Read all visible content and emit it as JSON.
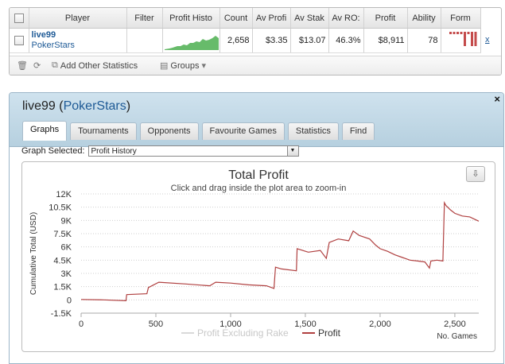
{
  "stats_table": {
    "headers": [
      "Player",
      "Filter",
      "Profit Histo",
      "Count",
      "Av Profi",
      "Av Stak",
      "Av RO:",
      "Profit",
      "Ability",
      "Form"
    ],
    "row": {
      "player": "live99",
      "site": "PokerStars",
      "filter": "",
      "count": "2,658",
      "av_profit": "$3.35",
      "av_stake": "$13.07",
      "av_roi": "46.3%",
      "profit": "$8,911",
      "ability": "78",
      "remove": "x"
    },
    "form_bars": [
      0.15,
      0.15,
      0.15,
      0.15,
      0.9,
      0.15,
      0.9,
      0.9
    ],
    "toolbar": {
      "add_other_statistics": "Add Other Statistics",
      "groups": "Groups"
    }
  },
  "panel": {
    "title_player": "live99",
    "title_site": "PokerStars",
    "close": "×",
    "tabs": [
      "Graphs",
      "Tournaments",
      "Opponents",
      "Favourite Games",
      "Statistics",
      "Find"
    ],
    "active_tab": 0,
    "graph_selected_label": "Graph Selected:",
    "graph_selected_value": "Profit History",
    "colors": {
      "profit_line": "#b04040",
      "excluding_rake_line": "#d9d9d9",
      "header_bg": "#bcd4e2"
    }
  },
  "chart_data": {
    "type": "line",
    "title": "Total Profit",
    "subtitle": "Click and drag inside the plot area to zoom-in",
    "xlabel": "No. Games",
    "ylabel": "Cumulative Total (USD)",
    "xlim": [
      0,
      2660
    ],
    "ylim": [
      -1500,
      12000
    ],
    "x_ticks": [
      0,
      500,
      1000,
      1500,
      2000,
      2500
    ],
    "x_tick_labels": [
      "0",
      "500",
      "1,000",
      "1,500",
      "2,000",
      "2,500"
    ],
    "y_ticks": [
      -1500,
      0,
      1500,
      3000,
      4500,
      6000,
      7500,
      9000,
      10500,
      12000
    ],
    "y_tick_labels": [
      "-1.5K",
      "0",
      "1.5K",
      "3K",
      "4.5K",
      "6K",
      "7.5K",
      "9K",
      "10.5K",
      "12K"
    ],
    "grid": true,
    "legend_position": "bottom",
    "series": [
      {
        "name": "Profit Excluding Rake",
        "values": []
      },
      {
        "name": "Profit",
        "x": [
          0,
          150,
          300,
          305,
          440,
          450,
          520,
          700,
          860,
          900,
          1000,
          1120,
          1240,
          1290,
          1300,
          1340,
          1440,
          1445,
          1520,
          1600,
          1640,
          1660,
          1720,
          1790,
          1820,
          1860,
          1930,
          1970,
          2000,
          2050,
          2100,
          2150,
          2200,
          2250,
          2300,
          2330,
          2340,
          2380,
          2420,
          2430,
          2440,
          2470,
          2500,
          2550,
          2600,
          2660
        ],
        "values": [
          50,
          0,
          -100,
          600,
          700,
          1400,
          2000,
          1800,
          1600,
          2000,
          1900,
          1700,
          1600,
          1300,
          3700,
          3500,
          3300,
          5800,
          5400,
          5600,
          4700,
          6500,
          6900,
          6700,
          7800,
          7300,
          6900,
          6200,
          5800,
          5500,
          5100,
          4800,
          4500,
          4400,
          4300,
          3600,
          4400,
          4500,
          4400,
          11000,
          10700,
          10200,
          9800,
          9500,
          9400,
          8911
        ]
      }
    ]
  }
}
